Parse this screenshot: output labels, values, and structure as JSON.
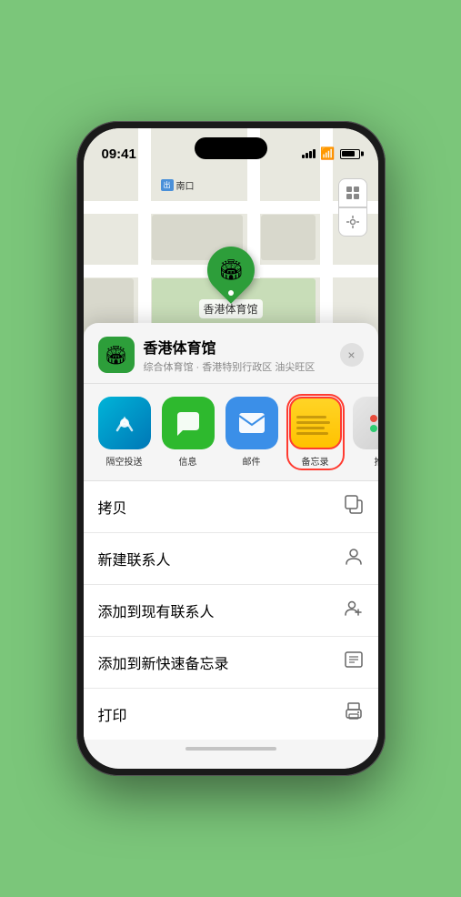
{
  "statusBar": {
    "time": "09:41",
    "locationIcon": "▶"
  },
  "map": {
    "label": "南口",
    "labelBadge": "出",
    "controls": {
      "mapIcon": "⊞",
      "locationIcon": "◎"
    },
    "stadiumName": "香港体育馆",
    "stadiumEmoji": "🏟"
  },
  "venueSheet": {
    "icon": "🏟",
    "name": "香港体育馆",
    "description": "综合体育馆 · 香港特别行政区 油尖旺区",
    "closeLabel": "×"
  },
  "shareItems": [
    {
      "id": "airdrop",
      "label": "隔空投送",
      "iconType": "airdrop"
    },
    {
      "id": "messages",
      "label": "信息",
      "iconType": "messages"
    },
    {
      "id": "mail",
      "label": "邮件",
      "iconType": "mail"
    },
    {
      "id": "notes",
      "label": "备忘录",
      "iconType": "notes",
      "selected": true
    },
    {
      "id": "more",
      "label": "推",
      "iconType": "more"
    }
  ],
  "actionItems": [
    {
      "id": "copy",
      "label": "拷贝",
      "icon": "copy"
    },
    {
      "id": "new-contact",
      "label": "新建联系人",
      "icon": "person"
    },
    {
      "id": "add-contact",
      "label": "添加到现有联系人",
      "icon": "person-add"
    },
    {
      "id": "quick-note",
      "label": "添加到新快速备忘录",
      "icon": "note"
    },
    {
      "id": "print",
      "label": "打印",
      "icon": "print"
    }
  ],
  "colors": {
    "green": "#2d9e3a",
    "blue": "#3b8fe8",
    "red": "#ff3b30",
    "bg": "#f5f5f5"
  }
}
